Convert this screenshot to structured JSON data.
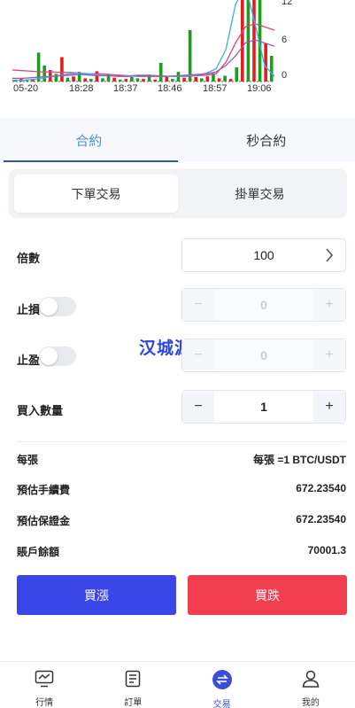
{
  "chart_data": {
    "type": "bar",
    "x_ticks": [
      "05-20",
      "18:28",
      "18:37",
      "18:46",
      "18:57",
      "19:06"
    ],
    "y_ticks": [
      "12",
      "6",
      "0"
    ],
    "bars": [
      {
        "color": "green",
        "value": 0.3
      },
      {
        "color": "red",
        "value": 0.5
      },
      {
        "color": "green",
        "value": 0.2
      },
      {
        "color": "red",
        "value": 0.4
      },
      {
        "color": "green",
        "value": 4.5
      },
      {
        "color": "green",
        "value": 2.5
      },
      {
        "color": "red",
        "value": 1.8
      },
      {
        "color": "green",
        "value": 1.2
      },
      {
        "color": "red",
        "value": 3.8
      },
      {
        "color": "green",
        "value": 0.6
      },
      {
        "color": "red",
        "value": 0.8
      },
      {
        "color": "green",
        "value": 1.5
      },
      {
        "color": "red",
        "value": 0.5
      },
      {
        "color": "green",
        "value": 0.4
      },
      {
        "color": "red",
        "value": 1.6
      },
      {
        "color": "green",
        "value": 0.5
      },
      {
        "color": "green",
        "value": 1.2
      },
      {
        "color": "red",
        "value": 0.6
      },
      {
        "color": "green",
        "value": 0.3
      },
      {
        "color": "red",
        "value": 0.4
      },
      {
        "color": "green",
        "value": 0.7
      },
      {
        "color": "green",
        "value": 0.5
      },
      {
        "color": "red",
        "value": 0.4
      },
      {
        "color": "green",
        "value": 1.1
      },
      {
        "color": "red",
        "value": 0.3
      },
      {
        "color": "green",
        "value": 2.9
      },
      {
        "color": "red",
        "value": 0.9
      },
      {
        "color": "green",
        "value": 0.4
      },
      {
        "color": "green",
        "value": 1.5
      },
      {
        "color": "red",
        "value": 0.6
      },
      {
        "color": "green",
        "value": 8.0
      },
      {
        "color": "red",
        "value": 0.7
      },
      {
        "color": "green",
        "value": 0.5
      },
      {
        "color": "red",
        "value": 0.8
      },
      {
        "color": "green",
        "value": 1.3
      },
      {
        "color": "red",
        "value": 0.5
      },
      {
        "color": "green",
        "value": 0.9
      },
      {
        "color": "red",
        "value": 0.4
      },
      {
        "color": "green",
        "value": 2.2
      },
      {
        "color": "red",
        "value": 15.0
      },
      {
        "color": "green",
        "value": 15.0
      },
      {
        "color": "red",
        "value": 15.0
      },
      {
        "color": "green",
        "value": 15.0
      },
      {
        "color": "red",
        "value": 6.0
      },
      {
        "color": "green",
        "value": 4.0
      }
    ],
    "lines": [
      {
        "color": "#e0457b",
        "values": [
          1.8,
          1.7,
          1.6,
          1.5,
          1.5,
          1.4,
          1.4,
          1.3,
          1.2,
          1.2,
          1.1,
          1.0,
          0.9,
          0.8,
          0.8,
          0.8,
          0.8,
          0.8,
          0.8,
          0.9,
          1.0,
          1.2,
          3.0,
          6.0,
          8.5,
          9.0,
          8.5,
          8.0
        ]
      },
      {
        "color": "#3ab0e8",
        "values": [
          0.2,
          0.2,
          0.3,
          0.5,
          0.8,
          1.0,
          1.2,
          1.3,
          1.2,
          1.0,
          0.9,
          0.8,
          0.9,
          1.0,
          1.0,
          0.9,
          0.8,
          0.8,
          0.9,
          1.0,
          1.3,
          2.0,
          5.0,
          12.0,
          15.0,
          9.0,
          2.5,
          0.8
        ]
      },
      {
        "color": "#9b59b6",
        "values": [
          0.5,
          0.5,
          0.6,
          0.7,
          0.8,
          0.9,
          1.0,
          1.1,
          1.0,
          0.9,
          0.9,
          0.8,
          0.8,
          0.9,
          0.9,
          0.9,
          0.8,
          0.9,
          1.0,
          1.1,
          1.2,
          1.5,
          2.5,
          4.0,
          6.0,
          6.5,
          6.0,
          5.5
        ]
      }
    ],
    "ylim": [
      0,
      12
    ]
  },
  "tabs": {
    "contract": "合約",
    "second_contract": "秒合約"
  },
  "order_type": {
    "market": "下單交易",
    "limit": "掛單交易"
  },
  "form": {
    "leverage_label": "倍數",
    "leverage_value": "100",
    "stop_loss_label": "止損",
    "stop_loss_value": "0",
    "take_profit_label": "止盈",
    "take_profit_value": "0",
    "quantity_label": "買入數量",
    "quantity_value": "1",
    "minus": "−",
    "plus": "+"
  },
  "watermark": "汉城源码",
  "info": {
    "per_contract_label": "每張",
    "per_contract_value": "每張 =1 BTC/USDT",
    "fee_label": "預估手續費",
    "fee_value": "672.23540",
    "margin_label": "預估保證金",
    "margin_value": "672.23540",
    "balance_label": "賬戶餘額",
    "balance_value": "70001.3"
  },
  "actions": {
    "buy": "買漲",
    "sell": "買跌"
  },
  "nav": {
    "market": "行情",
    "orders": "訂單",
    "trade": "交易",
    "mine": "我的"
  },
  "colors": {
    "accent": "#3a4fd6",
    "buy": "#3b46e8",
    "sell": "#f03e4f",
    "bar_green": "#1a9f1a",
    "bar_red": "#e02020"
  }
}
